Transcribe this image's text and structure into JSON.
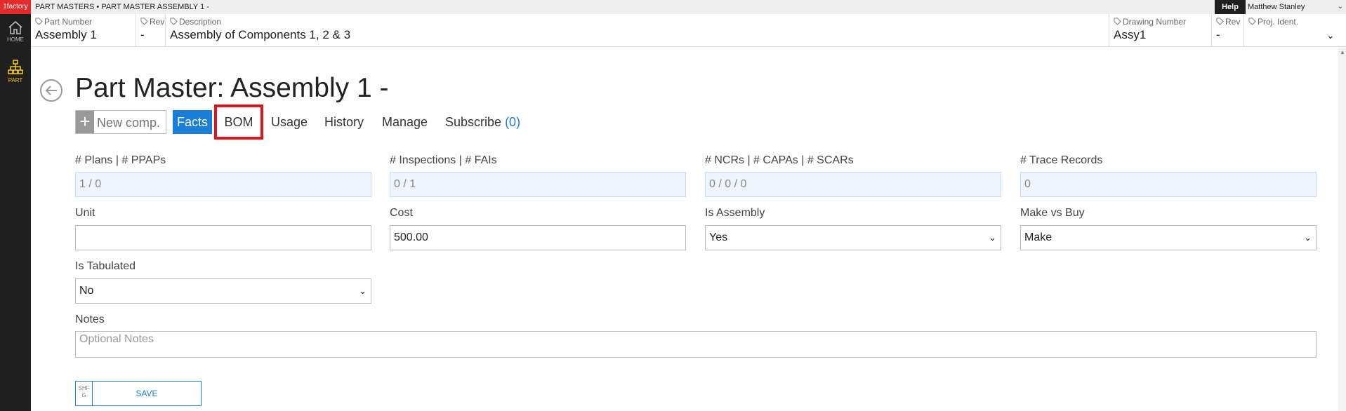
{
  "app": {
    "logo": "1factory",
    "breadcrumb": "PART MASTERS • PART MASTER ASSEMBLY 1 -"
  },
  "nav": [
    {
      "label": "HOME",
      "icon": "home-icon"
    },
    {
      "label": "PART",
      "icon": "hierarchy-icon",
      "active_color": "#f0c419"
    }
  ],
  "topbar": {
    "help": "Help",
    "user": "Matthew Stanley"
  },
  "header": {
    "part_number": {
      "label": "Part Number",
      "value": "Assembly 1"
    },
    "rev": {
      "label": "Rev",
      "value": "-"
    },
    "description": {
      "label": "Description",
      "value": "Assembly of Components 1, 2 & 3"
    },
    "drawing_number": {
      "label": "Drawing Number",
      "value": "Assy1"
    },
    "rev2": {
      "label": "Rev",
      "value": "-"
    },
    "proj_ident": {
      "label": "Proj. Ident.",
      "value": ""
    }
  },
  "page": {
    "title": "Part Master: Assembly 1 -"
  },
  "toolbar": {
    "new_comp_placeholder": "New comp.",
    "tabs": {
      "facts": "Facts",
      "bom": "BOM",
      "usage": "Usage",
      "history": "History",
      "manage": "Manage",
      "subscribe": "Subscribe",
      "subscribe_count": "(0)"
    }
  },
  "form": {
    "plans": {
      "label": "# Plans | # PPAPs",
      "value": "1 / 0"
    },
    "inspections": {
      "label": "# Inspections | # FAIs",
      "value": "0 / 1"
    },
    "ncrs": {
      "label": "# NCRs | # CAPAs | # SCARs",
      "value": "0 / 0 / 0"
    },
    "trace": {
      "label": "# Trace Records",
      "value": "0"
    },
    "unit": {
      "label": "Unit",
      "value": ""
    },
    "cost": {
      "label": "Cost",
      "value": "500.00"
    },
    "is_assembly": {
      "label": "Is Assembly",
      "value": "Yes"
    },
    "make_vs_buy": {
      "label": "Make vs Buy",
      "value": "Make"
    },
    "is_tabulated": {
      "label": "Is Tabulated",
      "value": "No"
    },
    "notes": {
      "label": "Notes",
      "placeholder": "Optional Notes"
    }
  },
  "save": {
    "hint": "SHF\nG",
    "label": "SAVE"
  },
  "colors": {
    "accent": "#1a7dd7",
    "highlight": "#e3151a",
    "logo": "#e32b2b"
  }
}
